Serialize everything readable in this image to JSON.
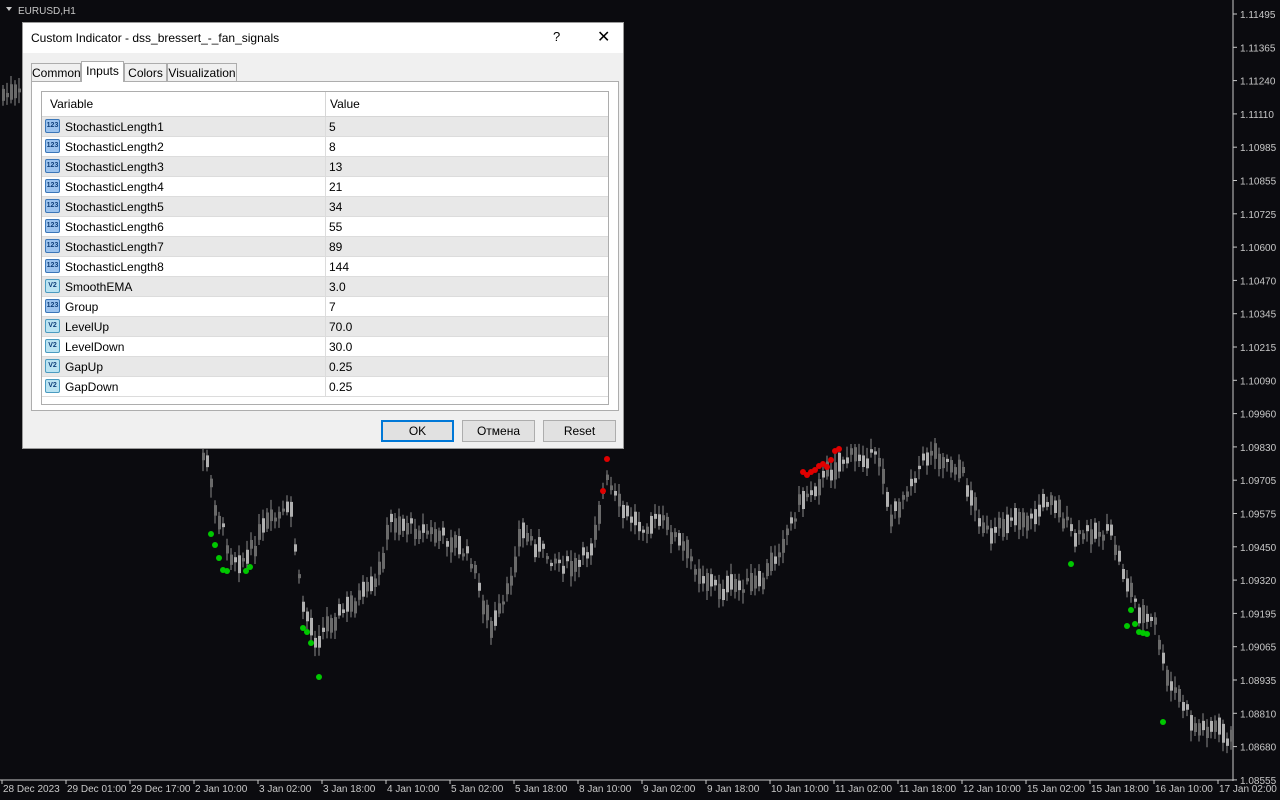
{
  "chart": {
    "symbol_label": "EURUSD,H1",
    "price_axis": [
      "1.11495",
      "1.11365",
      "1.11240",
      "1.11110",
      "1.10985",
      "1.10855",
      "1.10725",
      "1.10600",
      "1.10470",
      "1.10345",
      "1.10215",
      "1.10090",
      "1.09960",
      "1.09830",
      "1.09705",
      "1.09575",
      "1.09450",
      "1.09320",
      "1.09195",
      "1.09065",
      "1.08935",
      "1.08810",
      "1.08680",
      "1.08555"
    ],
    "time_axis": [
      "28 Dec 2023",
      "29 Dec 01:00",
      "29 Dec 17:00",
      "2 Jan 10:00",
      "3 Jan 02:00",
      "3 Jan 18:00",
      "4 Jan 10:00",
      "5 Jan 02:00",
      "5 Jan 18:00",
      "8 Jan 10:00",
      "9 Jan 02:00",
      "9 Jan 18:00",
      "10 Jan 10:00",
      "11 Jan 02:00",
      "11 Jan 18:00",
      "12 Jan 10:00",
      "15 Jan 02:00",
      "15 Jan 18:00",
      "16 Jan 10:00",
      "17 Jan 02:00"
    ],
    "colors": {
      "background": "#0b0b0f",
      "candle": "#8a8a8a",
      "buy_signal": "#00c800",
      "sell_signal": "#e00000",
      "axis_text": "#c8c8c8"
    }
  },
  "dialog": {
    "title": "Custom Indicator - dss_bressert_-_fan_signals",
    "help_label": "?",
    "close_label": "✕",
    "tabs": [
      {
        "label": "Common",
        "active": false
      },
      {
        "label": "Inputs",
        "active": true
      },
      {
        "label": "Colors",
        "active": false
      },
      {
        "label": "Visualization",
        "active": false
      }
    ],
    "columns": {
      "variable": "Variable",
      "value": "Value"
    },
    "rows": [
      {
        "name": "StochasticLength1",
        "value": "5",
        "type": "int",
        "icon": "123"
      },
      {
        "name": "StochasticLength2",
        "value": "8",
        "type": "int",
        "icon": "123"
      },
      {
        "name": "StochasticLength3",
        "value": "13",
        "type": "int",
        "icon": "123"
      },
      {
        "name": "StochasticLength4",
        "value": "21",
        "type": "int",
        "icon": "123"
      },
      {
        "name": "StochasticLength5",
        "value": "34",
        "type": "int",
        "icon": "123"
      },
      {
        "name": "StochasticLength6",
        "value": "55",
        "type": "int",
        "icon": "123"
      },
      {
        "name": "StochasticLength7",
        "value": "89",
        "type": "int",
        "icon": "123"
      },
      {
        "name": "StochasticLength8",
        "value": "144",
        "type": "int",
        "icon": "123"
      },
      {
        "name": "SmoothEMA",
        "value": "3.0",
        "type": "double",
        "icon": "V2"
      },
      {
        "name": "Group",
        "value": "7",
        "type": "int",
        "icon": "123"
      },
      {
        "name": "LevelUp",
        "value": "70.0",
        "type": "double",
        "icon": "V2"
      },
      {
        "name": "LevelDown",
        "value": "30.0",
        "type": "double",
        "icon": "V2"
      },
      {
        "name": "GapUp",
        "value": "0.25",
        "type": "double",
        "icon": "V2"
      },
      {
        "name": "GapDown",
        "value": "0.25",
        "type": "double",
        "icon": "V2"
      }
    ],
    "buttons": {
      "ok": "OK",
      "cancel": "Отмена",
      "reset": "Reset"
    }
  }
}
